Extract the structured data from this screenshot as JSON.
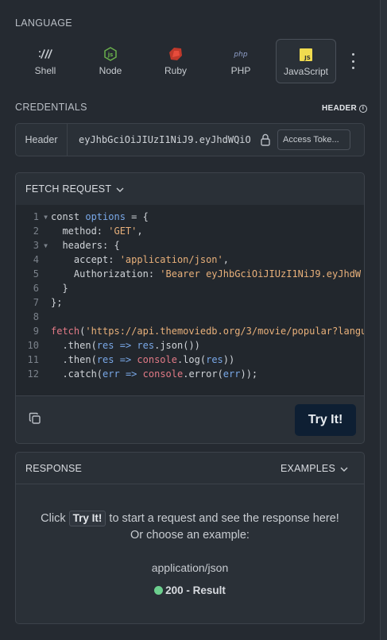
{
  "language": {
    "section_label": "LANGUAGE",
    "options": [
      {
        "label": "Shell",
        "icon": "shell-icon"
      },
      {
        "label": "Node",
        "icon": "node-icon"
      },
      {
        "label": "Ruby",
        "icon": "ruby-icon"
      },
      {
        "label": "PHP",
        "icon": "php-icon"
      },
      {
        "label": "JavaScript",
        "icon": "javascript-icon",
        "selected": true
      }
    ],
    "more_icon": "more-vertical-icon"
  },
  "credentials": {
    "section_label": "CREDENTIALS",
    "badge_label": "HEADER",
    "field_label": "Header",
    "token_value": "eyJhbGciOiJIUzI1NiJ9.eyJhdWQiOi...",
    "access_button_label": "Access Toke..."
  },
  "fetch_request": {
    "title": "FETCH REQUEST",
    "lines": [
      "const options = {",
      "  method: 'GET',",
      "  headers: {",
      "    accept: 'application/json',",
      "    Authorization: 'Bearer eyJhbGciOiJIUzI1NiJ9.eyJhdW",
      "  }",
      "};",
      "",
      "fetch('https://api.themoviedb.org/3/movie/popular?langu",
      "  .then(res => res.json())",
      "  .then(res => console.log(res))",
      "  .catch(err => console.error(err));"
    ],
    "try_button_label": "Try It!"
  },
  "response": {
    "title": "RESPONSE",
    "examples_label": "EXAMPLES",
    "message_before": "Click",
    "message_button": "Try It!",
    "message_after": "to start a request and see the response here!",
    "message_line2": "Or choose an example:",
    "mime_type": "application/json",
    "result_label": "200 - Result",
    "status_color": "#6ccf8e"
  }
}
